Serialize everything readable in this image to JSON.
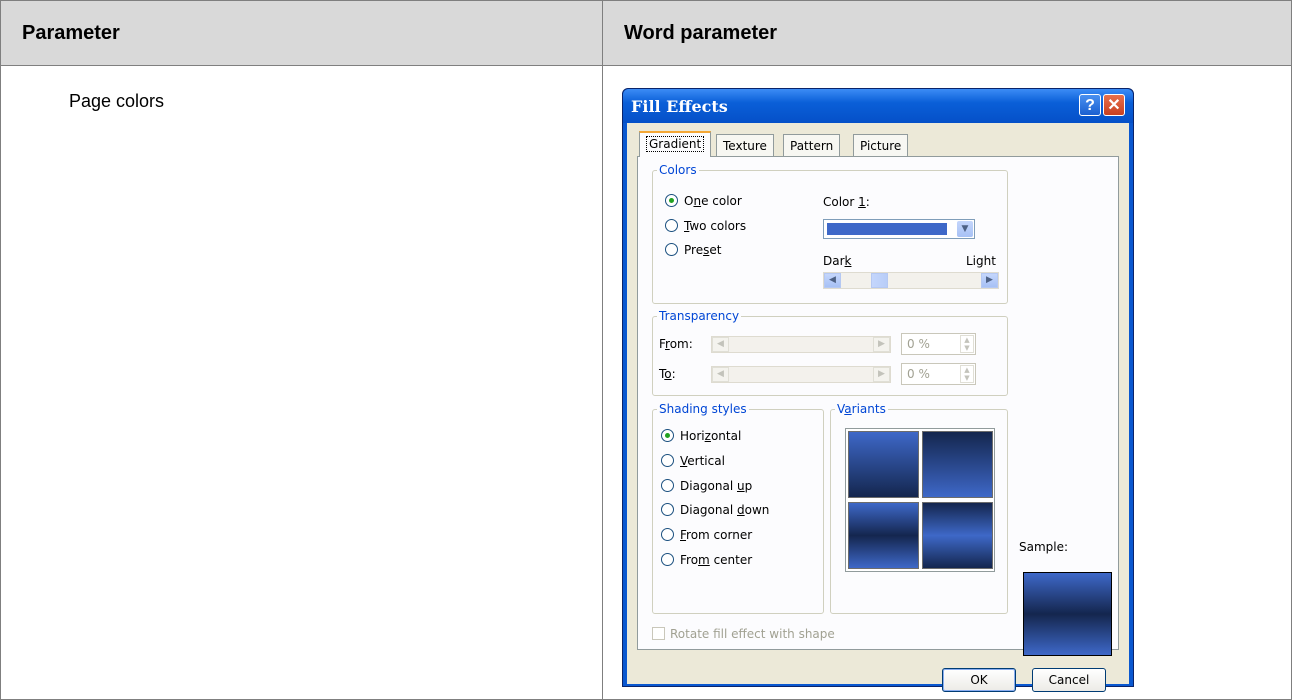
{
  "table": {
    "col1_header": "Parameter",
    "col2_header": "Word parameter",
    "row1_param": "Page colors"
  },
  "dialog": {
    "title": "Fill Effects",
    "help_glyph": "?",
    "close_glyph": "✕",
    "tabs": [
      "Gradient",
      "Texture",
      "Pattern",
      "Picture"
    ],
    "active_tab": "Gradient",
    "colors": {
      "legend": "Colors",
      "options": [
        {
          "pre": "O",
          "key": "n",
          "post": "e color",
          "selected": true
        },
        {
          "pre": "",
          "key": "T",
          "post": "wo colors",
          "selected": false
        },
        {
          "pre": "Pre",
          "key": "s",
          "post": "et",
          "selected": false
        }
      ],
      "color1_pre": "Color ",
      "color1_key": "1",
      "color1_post": ":",
      "color1_value_hex": "#3e68c8",
      "dark_pre": "Dar",
      "dark_key": "k",
      "light_label": "Light",
      "dark_light_level": 0.4
    },
    "transparency": {
      "legend": "Transparency",
      "from_pre": "F",
      "from_key": "r",
      "from_post": "om:",
      "to_pre": "T",
      "to_key": "o",
      "to_post": ":",
      "from_value": "0 %",
      "to_value": "0 %"
    },
    "shading": {
      "legend": "Shading styles",
      "options": [
        {
          "pre": "Hori",
          "key": "z",
          "post": "ontal",
          "selected": true
        },
        {
          "pre": "",
          "key": "V",
          "post": "ertical",
          "selected": false
        },
        {
          "pre": "Diagonal ",
          "key": "u",
          "post": "p",
          "selected": false
        },
        {
          "pre": "Diagonal ",
          "key": "d",
          "post": "own",
          "selected": false
        },
        {
          "pre": "",
          "key": "F",
          "post": "rom corner",
          "selected": false
        },
        {
          "pre": "Fro",
          "key": "m",
          "post": " center",
          "selected": false
        }
      ]
    },
    "variants": {
      "pre": "V",
      "key": "a",
      "post": "riants"
    },
    "sample_label": "Sample:",
    "rotate_label": "Rotate fill effect with shape",
    "ok_label": "OK",
    "cancel_label": "Cancel",
    "colors_hex": {
      "title_bar": "#0a5fd8",
      "gradient_light": "#3e68c8",
      "gradient_dark": "#14264e"
    }
  }
}
